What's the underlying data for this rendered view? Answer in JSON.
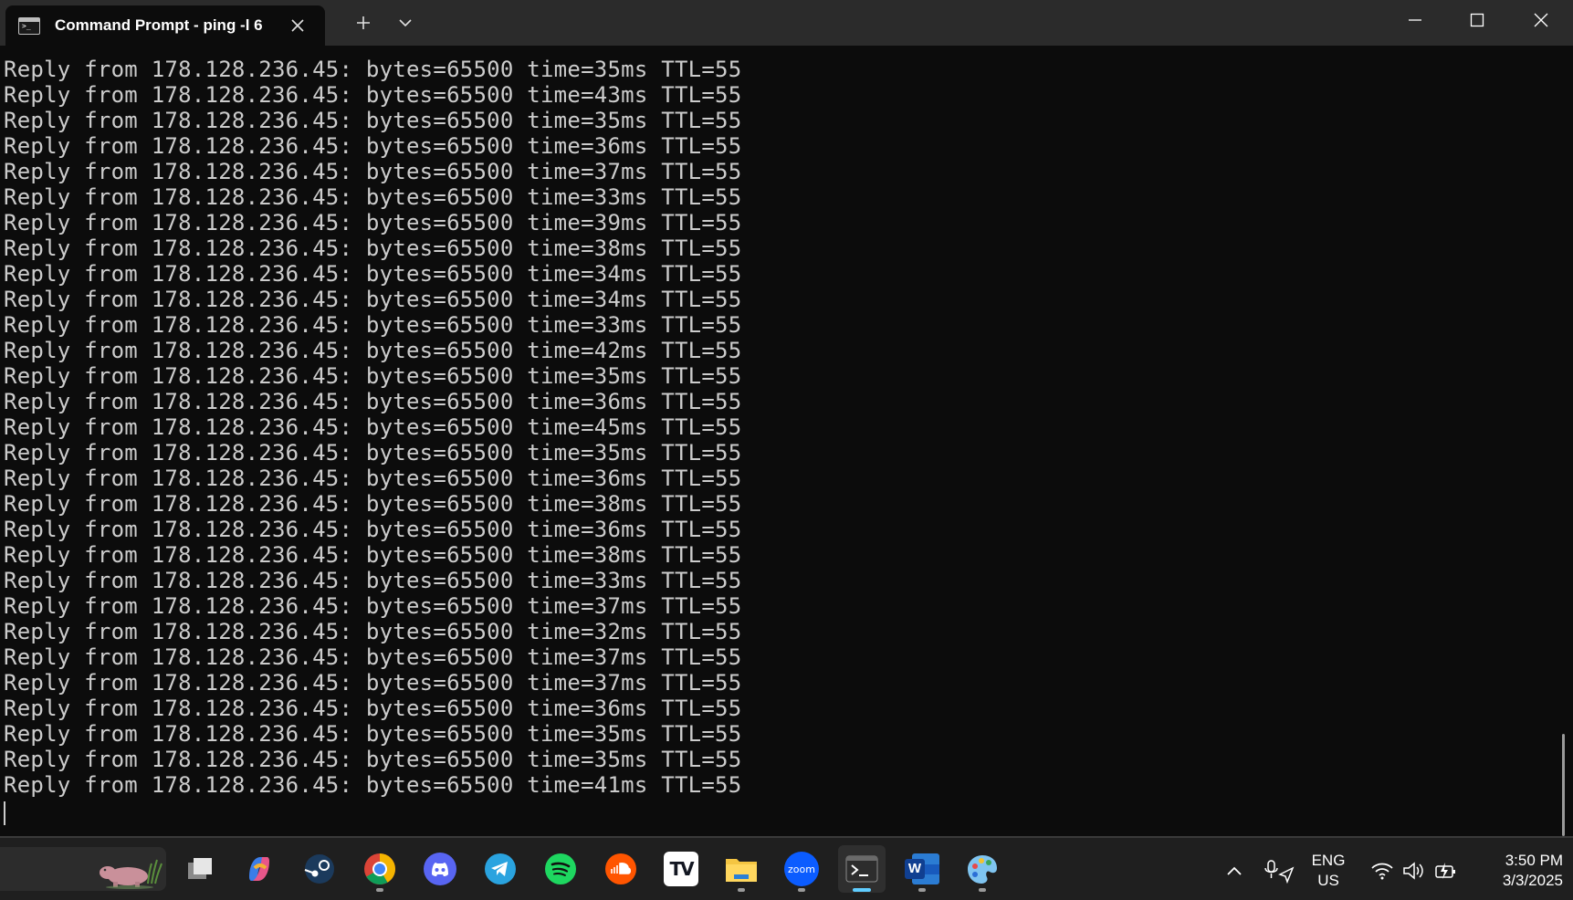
{
  "window": {
    "tab_title": "Command Prompt - ping  -l 6",
    "icons": {
      "tab": "cmd-icon",
      "close_tab": "close-icon",
      "new_tab": "plus-icon",
      "dropdown": "chevron-down-icon",
      "minimize": "minimize-icon",
      "maximize": "maximize-icon",
      "close": "close-icon"
    }
  },
  "terminal": {
    "lines": [
      "Reply from 178.128.236.45: bytes=65500 time=35ms TTL=55",
      "Reply from 178.128.236.45: bytes=65500 time=43ms TTL=55",
      "Reply from 178.128.236.45: bytes=65500 time=35ms TTL=55",
      "Reply from 178.128.236.45: bytes=65500 time=36ms TTL=55",
      "Reply from 178.128.236.45: bytes=65500 time=37ms TTL=55",
      "Reply from 178.128.236.45: bytes=65500 time=33ms TTL=55",
      "Reply from 178.128.236.45: bytes=65500 time=39ms TTL=55",
      "Reply from 178.128.236.45: bytes=65500 time=38ms TTL=55",
      "Reply from 178.128.236.45: bytes=65500 time=34ms TTL=55",
      "Reply from 178.128.236.45: bytes=65500 time=34ms TTL=55",
      "Reply from 178.128.236.45: bytes=65500 time=33ms TTL=55",
      "Reply from 178.128.236.45: bytes=65500 time=42ms TTL=55",
      "Reply from 178.128.236.45: bytes=65500 time=35ms TTL=55",
      "Reply from 178.128.236.45: bytes=65500 time=36ms TTL=55",
      "Reply from 178.128.236.45: bytes=65500 time=45ms TTL=55",
      "Reply from 178.128.236.45: bytes=65500 time=35ms TTL=55",
      "Reply from 178.128.236.45: bytes=65500 time=36ms TTL=55",
      "Reply from 178.128.236.45: bytes=65500 time=38ms TTL=55",
      "Reply from 178.128.236.45: bytes=65500 time=36ms TTL=55",
      "Reply from 178.128.236.45: bytes=65500 time=38ms TTL=55",
      "Reply from 178.128.236.45: bytes=65500 time=33ms TTL=55",
      "Reply from 178.128.236.45: bytes=65500 time=37ms TTL=55",
      "Reply from 178.128.236.45: bytes=65500 time=32ms TTL=55",
      "Reply from 178.128.236.45: bytes=65500 time=37ms TTL=55",
      "Reply from 178.128.236.45: bytes=65500 time=37ms TTL=55",
      "Reply from 178.128.236.45: bytes=65500 time=36ms TTL=55",
      "Reply from 178.128.236.45: bytes=65500 time=35ms TTL=55",
      "Reply from 178.128.236.45: bytes=65500 time=35ms TTL=55",
      "Reply from 178.128.236.45: bytes=65500 time=41ms TTL=55"
    ]
  },
  "taskbar": {
    "apps": [
      {
        "name": "task-view-icon",
        "running": false,
        "active": false
      },
      {
        "name": "copilot-icon",
        "running": false,
        "active": false
      },
      {
        "name": "steam-icon",
        "running": false,
        "active": false
      },
      {
        "name": "chrome-icon",
        "running": true,
        "active": false
      },
      {
        "name": "discord-icon",
        "running": false,
        "active": false
      },
      {
        "name": "telegram-icon",
        "running": false,
        "active": false
      },
      {
        "name": "spotify-icon",
        "running": false,
        "active": false
      },
      {
        "name": "soundcloud-icon",
        "running": false,
        "active": false
      },
      {
        "name": "tradingview-icon",
        "running": false,
        "active": false
      },
      {
        "name": "file-explorer-icon",
        "running": true,
        "active": false
      },
      {
        "name": "zoom-icon",
        "running": true,
        "active": false
      },
      {
        "name": "terminal-icon",
        "running": true,
        "active": true
      },
      {
        "name": "word-icon",
        "running": true,
        "active": false
      },
      {
        "name": "paint-icon",
        "running": true,
        "active": false
      }
    ],
    "zoom_label": "zoom",
    "tradingview_label": "TV",
    "word_label": "W",
    "tray": {
      "icons": [
        "chevron-up-icon",
        "microphone-location-icon",
        "wifi-icon",
        "speaker-icon",
        "battery-charging-icon"
      ],
      "language": "ENG",
      "region": "US",
      "time": "3:50 PM",
      "date": "3/3/2025"
    }
  },
  "colors": {
    "terminal_bg": "#0c0c0c",
    "terminal_text": "#cccccc",
    "titlebar_bg": "#2b2b2b",
    "taskbar_bg": "#1f1f1f",
    "accent": "#60cdff"
  }
}
